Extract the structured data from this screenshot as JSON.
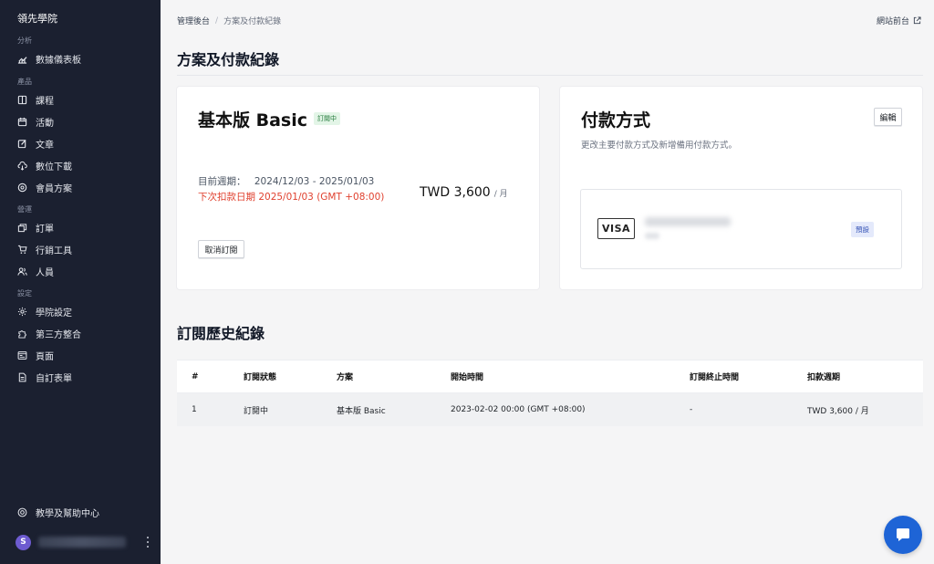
{
  "sidebar": {
    "brand": "領先學院",
    "sections": {
      "analytics": "分析",
      "products": "產品",
      "operations": "營運",
      "settings": "設定"
    },
    "items": [
      {
        "label": "數據儀表板",
        "icon": "chart-icon"
      },
      {
        "label": "課程",
        "icon": "book-icon"
      },
      {
        "label": "活動",
        "icon": "calendar-icon"
      },
      {
        "label": "文章",
        "icon": "edit-icon"
      },
      {
        "label": "數位下載",
        "icon": "cloud-download-icon"
      },
      {
        "label": "會員方案",
        "icon": "member-icon"
      },
      {
        "label": "訂單",
        "icon": "orders-icon"
      },
      {
        "label": "行銷工具",
        "icon": "cart-icon"
      },
      {
        "label": "人員",
        "icon": "users-icon"
      },
      {
        "label": "學院設定",
        "icon": "gear-icon"
      },
      {
        "label": "第三方整合",
        "icon": "puzzle-icon"
      },
      {
        "label": "頁面",
        "icon": "page-icon"
      },
      {
        "label": "自訂表單",
        "icon": "form-icon"
      }
    ],
    "help": "教學及幫助中心",
    "user_initial": "S"
  },
  "breadcrumb": {
    "root": "管理後台",
    "separator": "/",
    "current": "方案及付款紀錄"
  },
  "front_link": "網站前台",
  "page_title": "方案及付款紀錄",
  "plan": {
    "name": "基本版 Basic",
    "status": "訂閱中",
    "period_label": "目前週期：",
    "period_value": "2024/12/03 - 2025/01/03",
    "next_payment": "下次扣款日期 2025/01/03 (GMT +08:00)",
    "price": "TWD 3,600",
    "per": "/ 月",
    "cancel_label": "取消訂閱"
  },
  "payment": {
    "title": "付款方式",
    "subtitle": "更改主要付款方式及新增備用付款方式。",
    "edit_label": "編輯",
    "card_brand": "VISA",
    "default_badge": "預設"
  },
  "history": {
    "title": "訂閱歷史紀錄",
    "columns": [
      "#",
      "訂閱狀態",
      "方案",
      "開始時間",
      "訂閱終止時間",
      "扣款週期"
    ],
    "rows": [
      [
        "1",
        "訂閱中",
        "基本版 Basic",
        "2023-02-02 00:00 (GMT +08:00)",
        "-",
        "TWD 3,600 / 月"
      ]
    ]
  },
  "colors": {
    "sidebar_bg": "#1b2030",
    "accent_red": "#e0412f",
    "badge_green": "#237a3b",
    "badge_blue": "#3553b5",
    "chat_blue": "#1e64d6"
  }
}
